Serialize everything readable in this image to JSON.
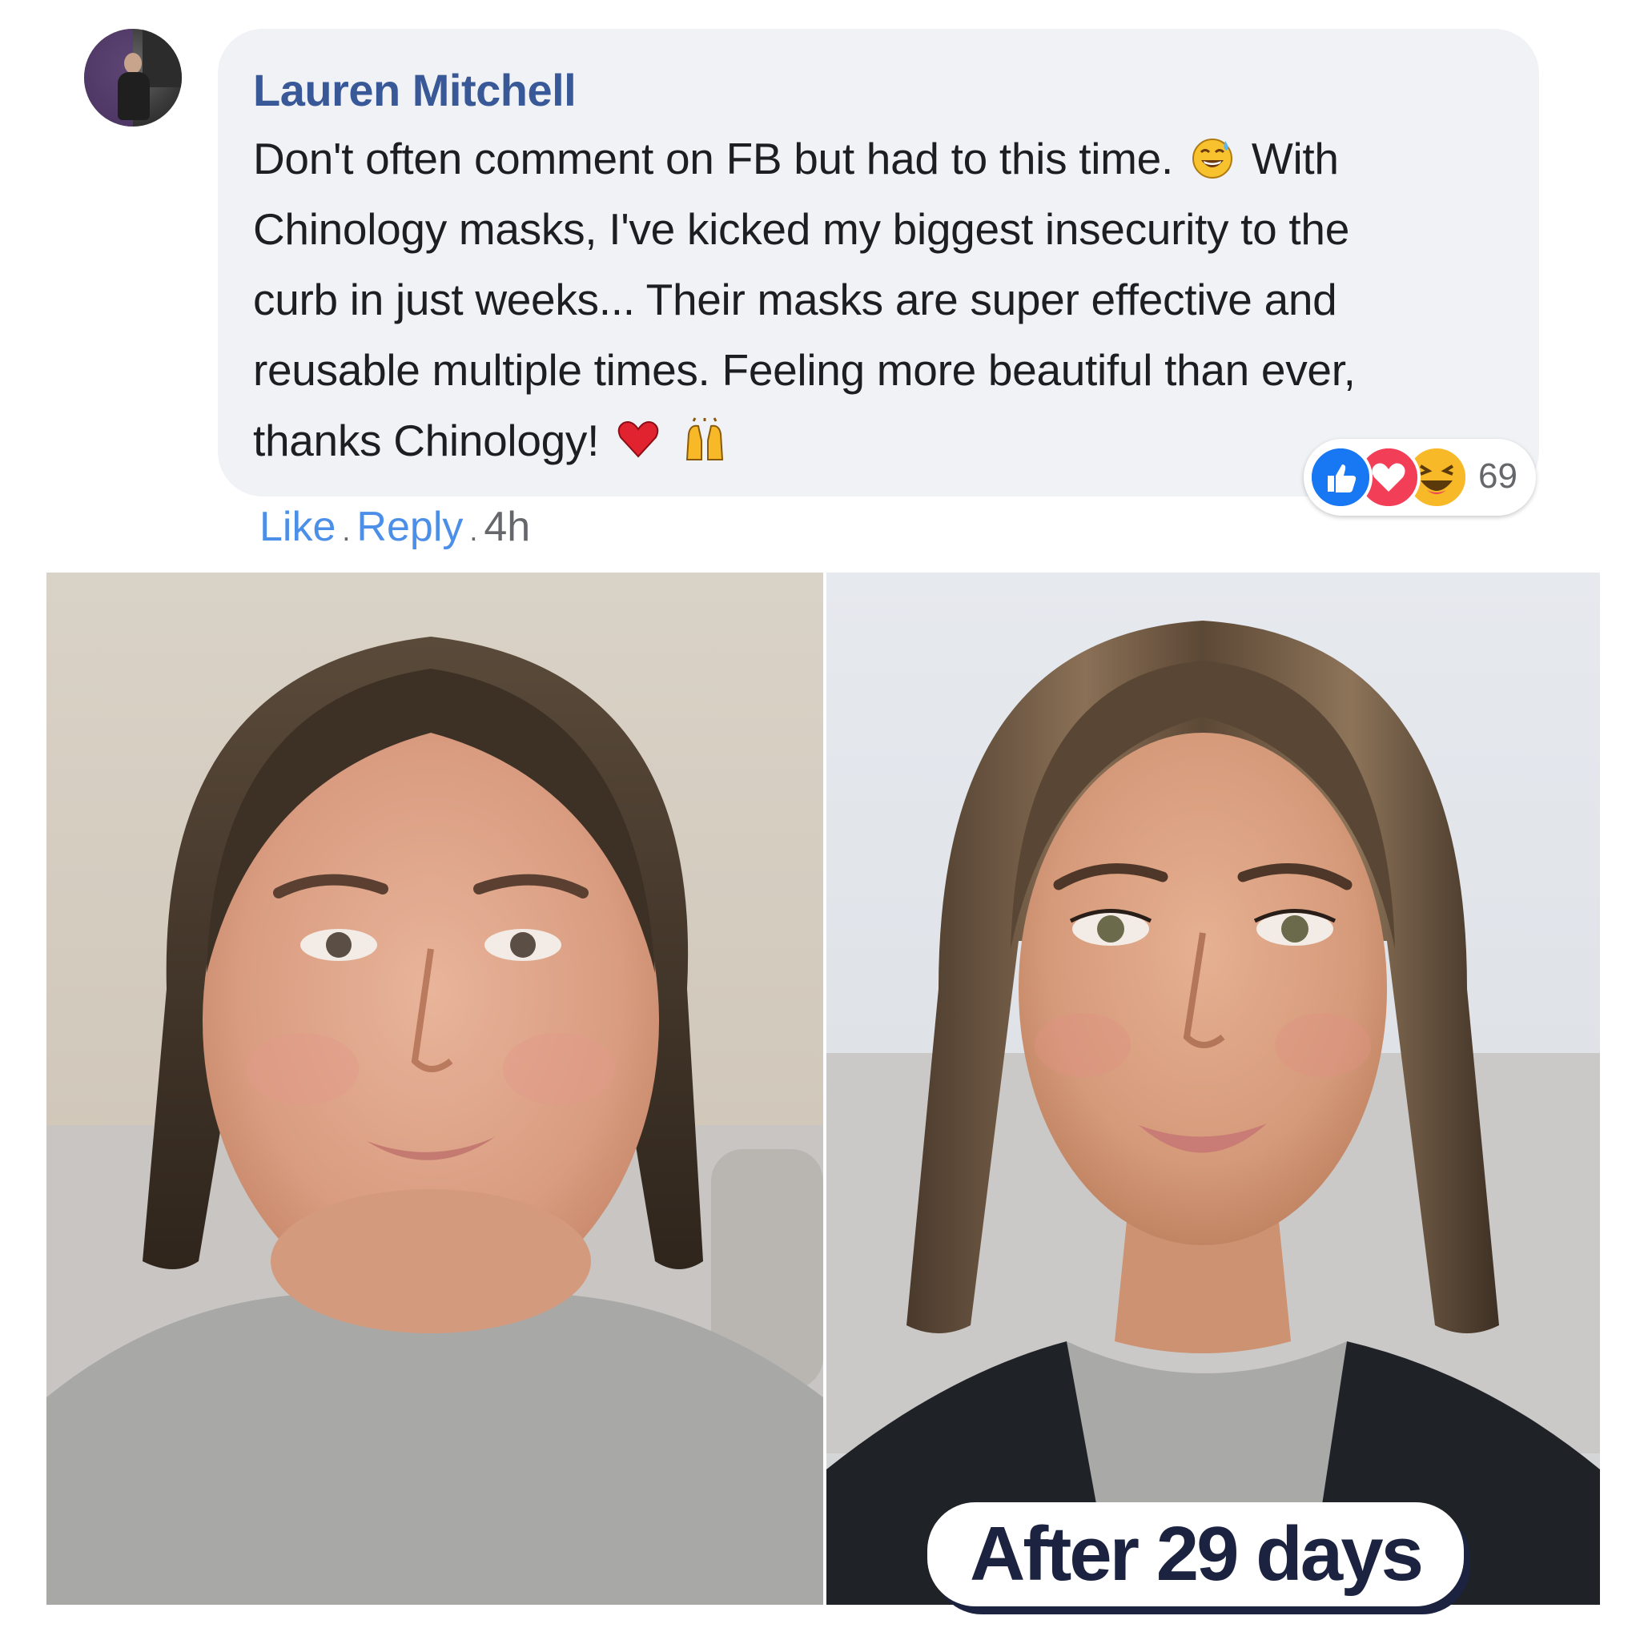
{
  "comment": {
    "author": "Lauren Mitchell",
    "lines": [
      "Don't often comment on FB but had to this time.",
      "With",
      "Chinology masks, I've kicked my biggest insecurity to the",
      "curb in just weeks... Their masks are super effective and",
      "reusable multiple times. Feeling more beautiful than ever,",
      "thanks Chinology!"
    ],
    "emoji_icons": [
      "grinning-sweat-icon",
      "red-heart-icon",
      "raising-hands-icon"
    ]
  },
  "reactions": {
    "icons": [
      "like-icon",
      "love-icon",
      "haha-icon"
    ],
    "count": "69"
  },
  "actions": {
    "like": "Like",
    "separator": ".",
    "reply": "Reply",
    "time": "4h"
  },
  "photos": {
    "after_label": "After 29 days"
  },
  "colors": {
    "author": "#385898",
    "bubble": "#f0f2f5",
    "link": "#4c8fe8",
    "badge_text": "#1b2340",
    "like": "#1877f2",
    "love": "#f33e58",
    "haha": "#f7b928"
  }
}
